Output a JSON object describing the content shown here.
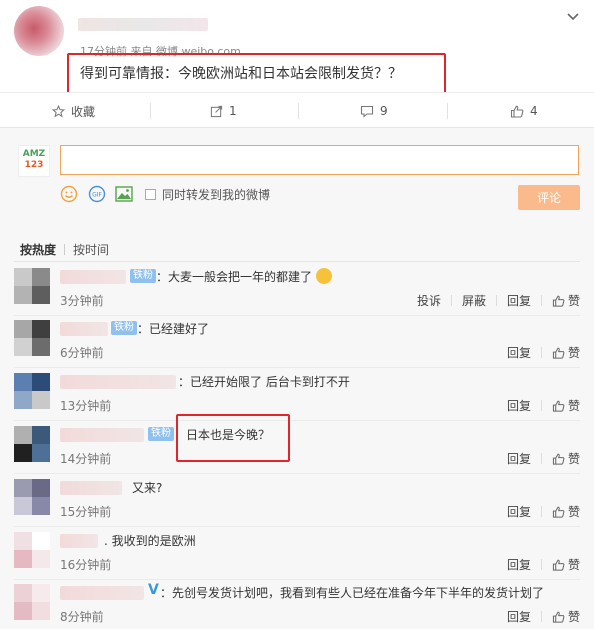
{
  "post": {
    "meta": "17分钟前 来自 微博 weibo.com",
    "text": "得到可靠情报：今晚欧洲站和日本站会限制发货？？"
  },
  "actions": {
    "favorite": "收藏",
    "repost": "1",
    "comment": "9",
    "like": "4"
  },
  "composer": {
    "avatar_line1": "AMZ",
    "avatar_line2": "123",
    "repost_label": "同时转发到我的微博",
    "submit_label": "评论"
  },
  "sort": {
    "by_heat": "按热度",
    "by_time": "按时间"
  },
  "comments": [
    {
      "badge": "铁粉",
      "text": "：大麦一般会把一年的都建了",
      "time": "3分钟前",
      "actions": [
        "投诉",
        "屏蔽",
        "回复"
      ],
      "like": "赞"
    },
    {
      "badge": "铁粉",
      "text": "：已经建好了",
      "time": "6分钟前",
      "actions": [
        "回复"
      ],
      "like": "赞"
    },
    {
      "badge": "",
      "text": "：已经开始限了 后台卡到打不开",
      "time": "13分钟前",
      "actions": [
        "回复"
      ],
      "like": "赞"
    },
    {
      "badge": "铁粉",
      "text": "：日本也是今晚？",
      "time": "14分钟前",
      "actions": [
        "回复"
      ],
      "like": "赞"
    },
    {
      "badge": "",
      "text": "又来?",
      "time": "15分钟前",
      "actions": [
        "回复"
      ],
      "like": "赞"
    },
    {
      "badge": "",
      "text": ". 我收到的是欧洲",
      "time": "16分钟前",
      "actions": [
        "回复"
      ],
      "like": "赞"
    },
    {
      "badge": "V",
      "text": "：先创号发货计划吧，我看到有些人已经在准备今年下半年的发货计划了",
      "time": "8分钟前",
      "actions": [
        "回复"
      ],
      "like": "赞"
    }
  ],
  "colors": {
    "highlight_border": "#e0262a",
    "input_border": "#f2a55a",
    "submit_bg": "#fbba8c",
    "badge_bg": "#8fc0ee"
  }
}
